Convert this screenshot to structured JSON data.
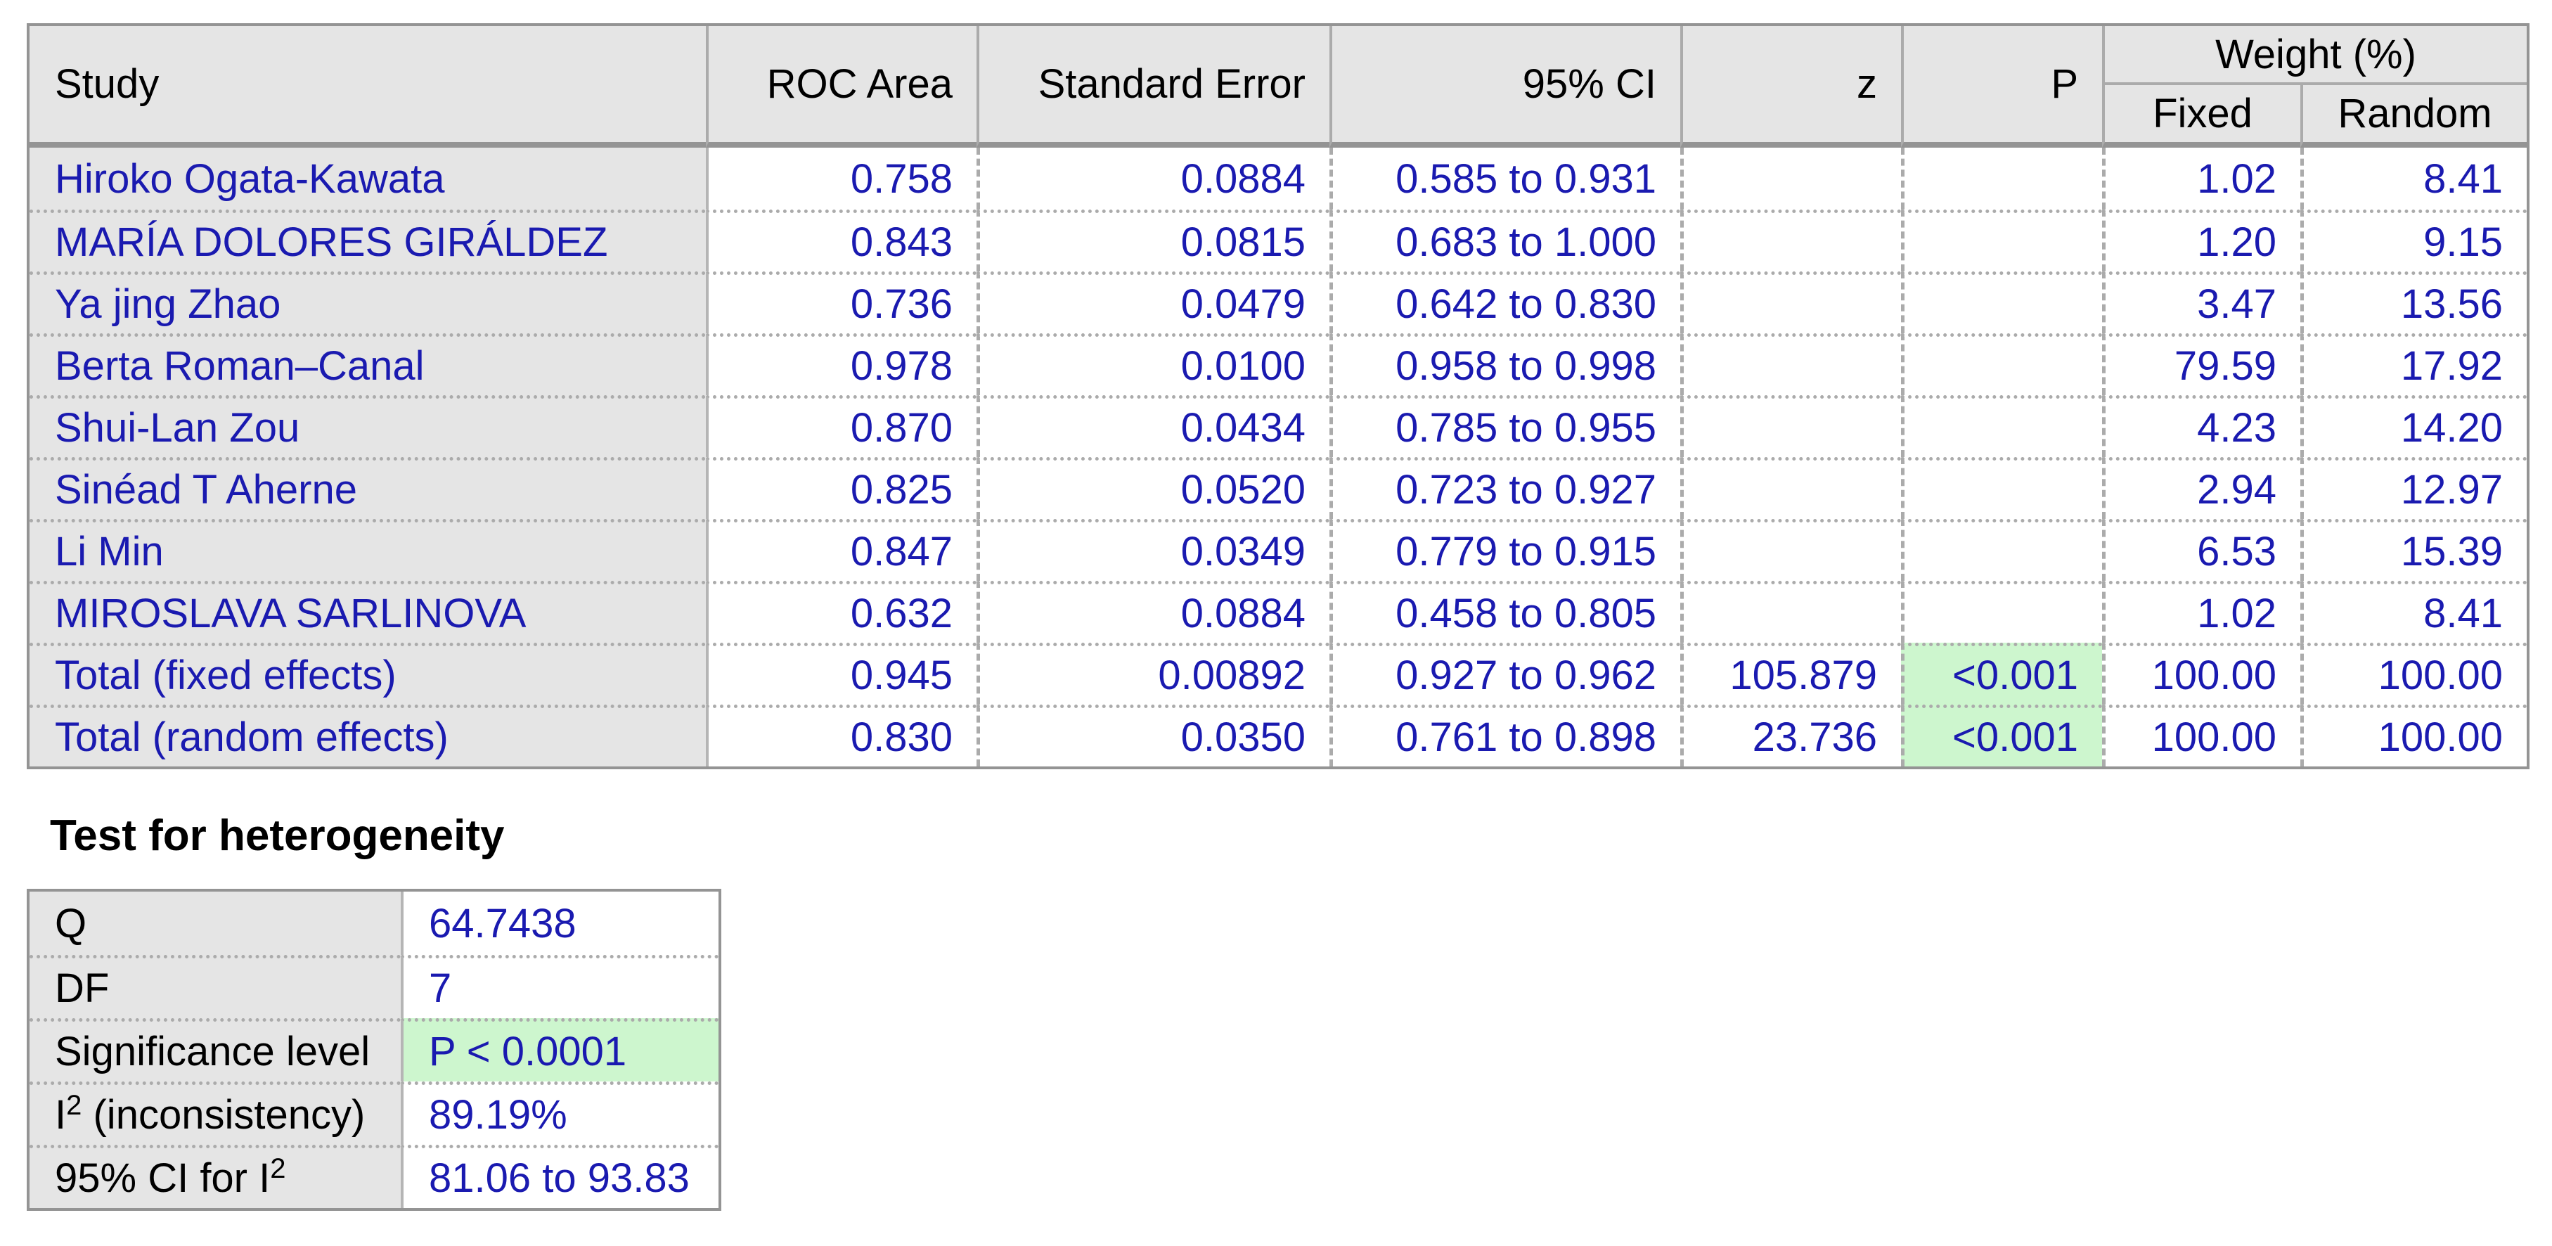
{
  "colors": {
    "value_blue": "#1A1AB0",
    "significant_green": "#CDF6CE",
    "panel_gray": "#E5E5E5",
    "border_gray": "#949494"
  },
  "main_table": {
    "headers": {
      "study": "Study",
      "roc": "ROC Area",
      "se": "Standard Error",
      "ci": "95% CI",
      "z": "z",
      "p": "P",
      "weight": "Weight (%)",
      "fixed": "Fixed",
      "random": "Random"
    },
    "rows": [
      {
        "study": "Hiroko Ogata-Kawata",
        "roc": "0.758",
        "se": "0.0884",
        "ci": "0.585 to 0.931",
        "z": "",
        "p": "",
        "fixed": "1.02",
        "random": "8.41"
      },
      {
        "study": "MARÍA DOLORES GIRÁLDEZ",
        "roc": "0.843",
        "se": "0.0815",
        "ci": "0.683 to 1.000",
        "z": "",
        "p": "",
        "fixed": "1.20",
        "random": "9.15"
      },
      {
        "study": "Ya jing Zhao",
        "roc": "0.736",
        "se": "0.0479",
        "ci": "0.642 to 0.830",
        "z": "",
        "p": "",
        "fixed": "3.47",
        "random": "13.56"
      },
      {
        "study": "Berta Roman–Canal",
        "roc": "0.978",
        "se": "0.0100",
        "ci": "0.958 to 0.998",
        "z": "",
        "p": "",
        "fixed": "79.59",
        "random": "17.92"
      },
      {
        "study": "Shui-Lan Zou",
        "roc": "0.870",
        "se": "0.0434",
        "ci": "0.785 to 0.955",
        "z": "",
        "p": "",
        "fixed": "4.23",
        "random": "14.20"
      },
      {
        "study": "Sinéad T Aherne",
        "roc": "0.825",
        "se": "0.0520",
        "ci": "0.723 to 0.927",
        "z": "",
        "p": "",
        "fixed": "2.94",
        "random": "12.97"
      },
      {
        "study": "Li Min",
        "roc": "0.847",
        "se": "0.0349",
        "ci": "0.779 to 0.915",
        "z": "",
        "p": "",
        "fixed": "6.53",
        "random": "15.39"
      },
      {
        "study": "MIROSLAVA SARLINOVA",
        "roc": "0.632",
        "se": "0.0884",
        "ci": "0.458 to 0.805",
        "z": "",
        "p": "",
        "fixed": "1.02",
        "random": "8.41"
      },
      {
        "study": "Total (fixed effects)",
        "roc": "0.945",
        "se": "0.00892",
        "ci": "0.927 to 0.962",
        "z": "105.879",
        "p": "<0.001",
        "fixed": "100.00",
        "random": "100.00"
      },
      {
        "study": "Total (random effects)",
        "roc": "0.830",
        "se": "0.0350",
        "ci": "0.761 to 0.898",
        "z": "23.736",
        "p": "<0.001",
        "fixed": "100.00",
        "random": "100.00"
      }
    ]
  },
  "heterogeneity": {
    "title": "Test for heterogeneity",
    "rows": [
      {
        "label_pre": "Q",
        "label_sup": "",
        "label_post": "",
        "value": "64.7438",
        "highlight": false
      },
      {
        "label_pre": "DF",
        "label_sup": "",
        "label_post": "",
        "value": "7",
        "highlight": false
      },
      {
        "label_pre": "Significance level",
        "label_sup": "",
        "label_post": "",
        "value": "P < 0.0001",
        "highlight": true
      },
      {
        "label_pre": "I",
        "label_sup": "2",
        "label_post": " (inconsistency)",
        "value": "89.19%",
        "highlight": false
      },
      {
        "label_pre": "95% CI for I",
        "label_sup": "2",
        "label_post": "",
        "value": "81.06 to 93.83",
        "highlight": false
      }
    ]
  }
}
